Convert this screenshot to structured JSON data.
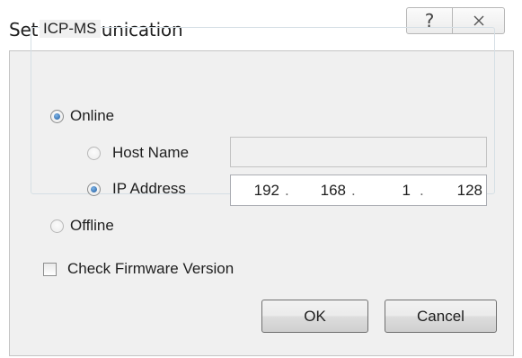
{
  "window": {
    "title": "Set Communication",
    "help_glyph": "?",
    "help_icon": "question-mark-icon",
    "close_icon": "close-x-icon"
  },
  "groupbox": {
    "label": "ICP-MS"
  },
  "connection": {
    "online_label": "Online",
    "online_selected": true,
    "host_name_label": "Host Name",
    "host_name_selected": false,
    "host_name_value": "",
    "ip_address_label": "IP Address",
    "ip_address_selected": true,
    "ip_octets": [
      "192",
      "168",
      "1",
      "128"
    ],
    "ip_separator": ".",
    "offline_label": "Offline",
    "offline_selected": false
  },
  "check_firmware": {
    "label": "Check Firmware Version",
    "checked": false
  },
  "buttons": {
    "ok_label": "OK",
    "cancel_label": "Cancel"
  },
  "colors": {
    "radio_dot": "#1d5a9e",
    "client_background": "#f0f0f0"
  }
}
